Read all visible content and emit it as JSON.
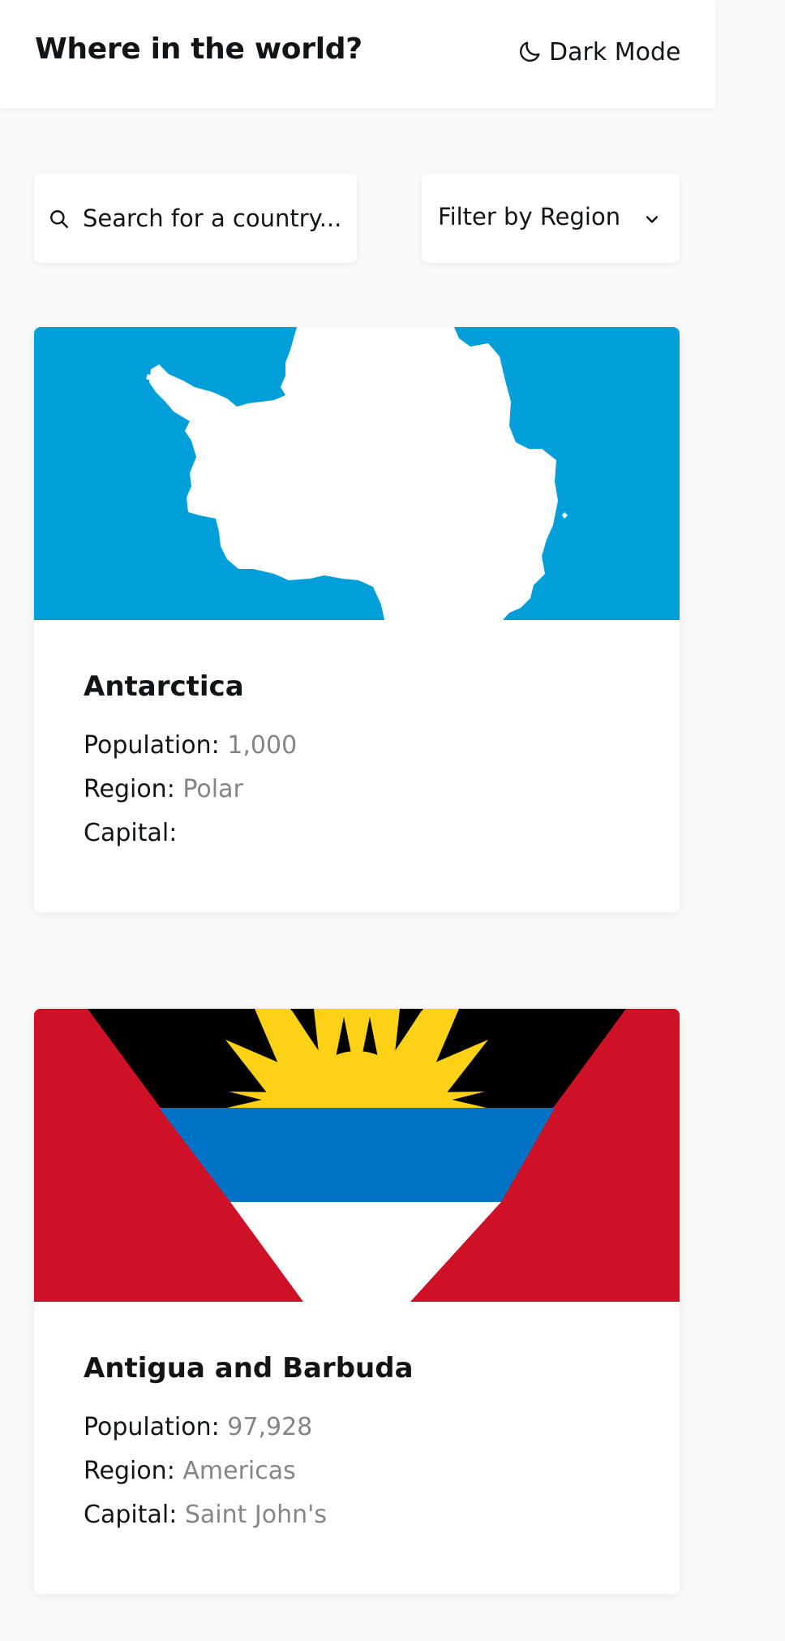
{
  "header": {
    "title": "Where in the world?",
    "theme_toggle_label": "Dark Mode",
    "theme_toggle_icon": "moon-icon"
  },
  "search": {
    "placeholder": "Search for a country...",
    "value": "",
    "icon": "search-icon"
  },
  "filter": {
    "label": "Filter by Region",
    "icon": "chevron-down-icon"
  },
  "labels": {
    "population": "Population:",
    "region": "Region:",
    "capital": "Capital:"
  },
  "countries": [
    {
      "name": "Antarctica",
      "population": "1,000",
      "region": "Polar",
      "capital": "",
      "flag_colors": {
        "background": "#009FDA",
        "continent": "#FFFFFF"
      }
    },
    {
      "name": "Antigua and Barbuda",
      "population": "97,928",
      "region": "Americas",
      "capital": "Saint John's",
      "flag_colors": {
        "red": "#CE1126",
        "black": "#000000",
        "sun": "#FCD116",
        "blue": "#0072C6",
        "white": "#FFFFFF"
      }
    }
  ],
  "colors": {
    "background": "#FAFAFA",
    "surface": "#FFFFFF",
    "text": "#111517",
    "muted_text": "#858585"
  }
}
